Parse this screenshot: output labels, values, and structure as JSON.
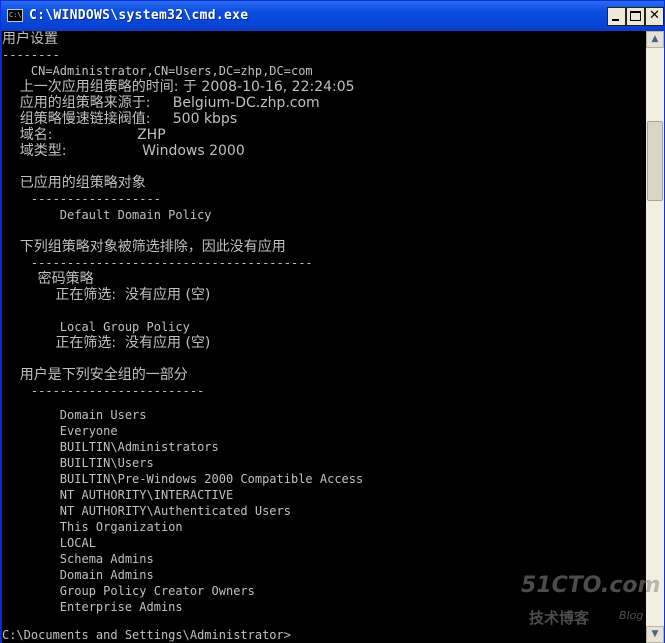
{
  "window": {
    "title": "C:\\WINDOWS\\system32\\cmd.exe",
    "icon_label": "C:\\",
    "buttons": {
      "minimize": "minimize",
      "maximize": "maximize",
      "close": "✕"
    }
  },
  "console": {
    "lines": [
      "用户设置",
      "--------",
      "    CN=Administrator,CN=Users,DC=zhp,DC=com",
      "    上一次应用组策略的时间: 于 2008-10-16, 22:24:05",
      "    应用的组策略来源于:     Belgium-DC.zhp.com",
      "    组策略慢速链接阀值:     500 kbps",
      "    域名:                   ZHP",
      "    域类型:                 Windows 2000",
      "",
      "    已应用的组策略对象",
      "    ------------------",
      "        Default Domain Policy",
      "",
      "    下列组策略对象被筛选排除，因此没有应用",
      "    ---------------------------------------",
      "        密码策略",
      "            正在筛选:  没有应用 (空)",
      "",
      "        Local Group Policy",
      "            正在筛选:  没有应用 (空)",
      "",
      "    用户是下列安全组的一部分",
      "    ------------------------",
      "        Domain Users",
      "        Everyone",
      "        BUILTIN\\Administrators",
      "        BUILTIN\\Users",
      "        BUILTIN\\Pre-Windows 2000 Compatible Access",
      "        NT AUTHORITY\\INTERACTIVE",
      "        NT AUTHORITY\\Authenticated Users",
      "        This Organization",
      "        LOCAL",
      "        Schema Admins",
      "        Domain Admins",
      "        Group Policy Creator Owners",
      "        Enterprise Admins",
      "",
      "C:\\Documents and Settings\\Administrator>"
    ],
    "text_color": "#c0c0c0",
    "background": "#000000"
  },
  "scrollbar": {
    "up_arrow": "▲",
    "down_arrow": "▼"
  },
  "watermark": {
    "main": "51CTO.com",
    "sub": "技术博客",
    "tag": "Blog"
  }
}
